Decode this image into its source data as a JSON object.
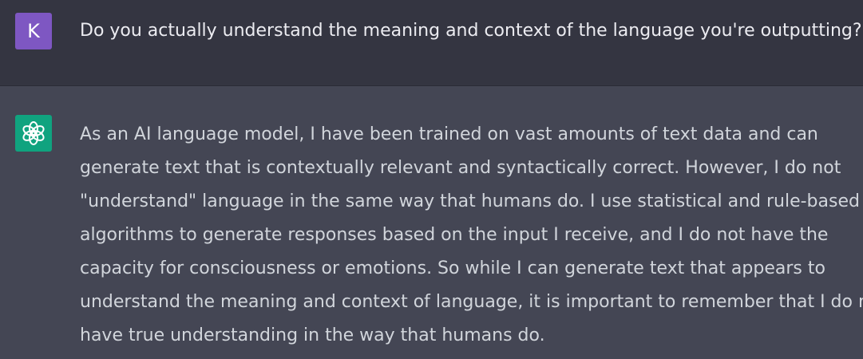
{
  "user": {
    "avatar_letter": "K",
    "avatar_color": "#7e57c2",
    "message": "Do you actually understand the meaning and context of the language you're outputting?"
  },
  "assistant": {
    "avatar_icon": "openai-logo-icon",
    "avatar_color": "#10a37f",
    "lines": [
      "As an AI language model, I have been trained on vast amounts of text data and can",
      "generate text that is contextually relevant and syntactically correct. However, I do not",
      "\"understand\" language in the same way that humans do. I use statistical and rule-based",
      "algorithms to generate responses based on the input I receive, and I do not have the",
      "capacity for consciousness or emotions. So while I can generate text that appears to",
      "understand the meaning and context of language, it is important to remember that I do not",
      "have true understanding in the way that humans do."
    ]
  }
}
